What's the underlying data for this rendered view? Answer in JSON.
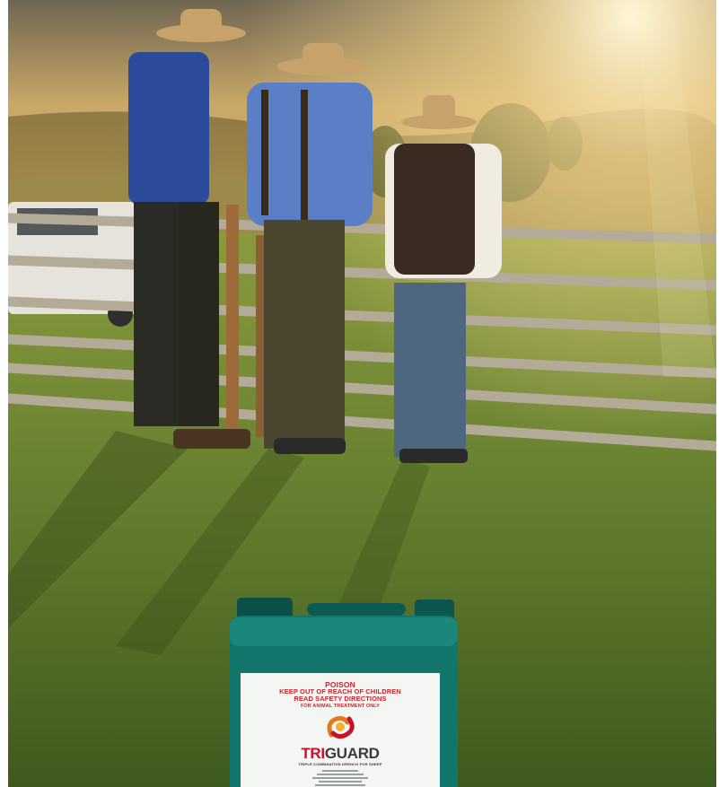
{
  "scene": {
    "description_icon": "farm-photo",
    "colors": {
      "sky": "#b79a5e",
      "grass": "#5f7a2c",
      "fence": "#a39c8e",
      "jerry_can": "#0f6b63"
    }
  },
  "product": {
    "label": {
      "poison": "POISON",
      "keep_out": "KEEP OUT OF REACH OF CHILDREN",
      "read_safety": "READ SAFETY DIRECTIONS",
      "animal_only": "FOR ANIMAL TREATMENT ONLY",
      "brand_part1": "TRI",
      "brand_part2": "GUARD",
      "tagline": "TRIPLE COMBINATION DRENCH FOR SHEEP"
    }
  }
}
